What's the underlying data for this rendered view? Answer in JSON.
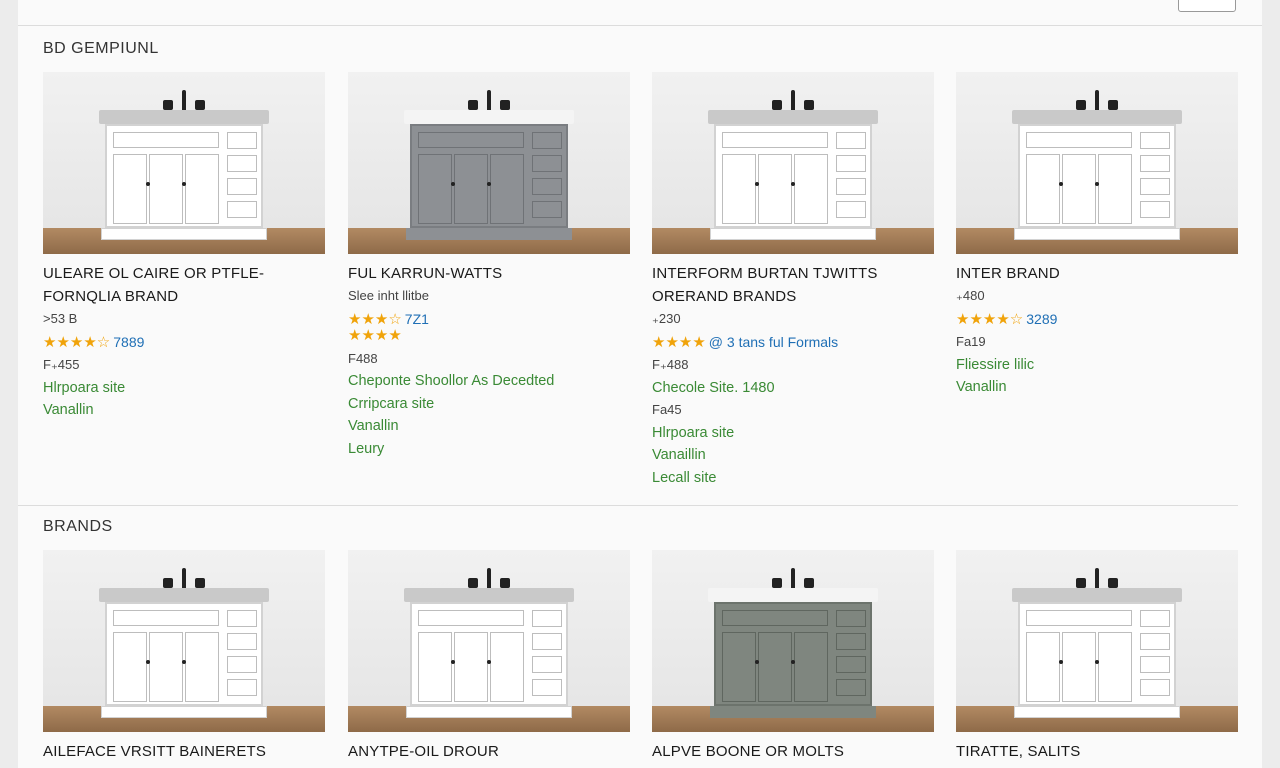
{
  "colors": {
    "accent_green": "#3a8a35",
    "accent_blue": "#1f6fb5",
    "star": "#f0a30a"
  },
  "sections": [
    {
      "title": "BD GEMPIUNL"
    },
    {
      "title": "BRANDS"
    }
  ],
  "products_top": [
    {
      "title": "ULEARE OL CAIRE OR PTFLE- FORNQLIA BRAND",
      "line1": ">53 B",
      "stars": "★★★★",
      "stars_empty": "☆",
      "rating": "7889",
      "price": "F₊455",
      "link1": "Hlrpoara site",
      "link2": "Vanallin",
      "cabinet_color": "#ffffff"
    },
    {
      "title": "FUL KARRUN-WATTS",
      "line1": "Slee inht llitbe",
      "stars": "★★★",
      "stars_empty": "☆",
      "rating": "7Z1",
      "stars2": "★★★",
      "stars2_empty": "★",
      "price": "F488",
      "link1": "Cheponte Shoollor As Decedted",
      "link2": "Crripcara site",
      "link3": "Vanallin",
      "link4": "Leury",
      "cabinet_color": "#8d9094"
    },
    {
      "title": "INTERFORM BURTAN TJWITTS ORERAND BRANDS",
      "line1": "₊230",
      "stars": "★★★★",
      "rating": "@ 3 tans ful Formals",
      "price": "F₊488",
      "link1": "Checole Site. 1480",
      "line2": "Fa45",
      "link2": "Hlrpoara site",
      "link3": "Vanaillin",
      "link4": "Lecall site",
      "cabinet_color": "#ffffff"
    },
    {
      "title": "INTER BRAND",
      "line1": "₊480",
      "stars": "★★★★",
      "stars_empty": "☆",
      "rating": "3289",
      "price": "Fa19",
      "link1": "Fliessire lilic",
      "link2": "Vanallin",
      "cabinet_color": "#ffffff"
    }
  ],
  "products_bottom": [
    {
      "title": "AILEFACE VRSITT BAINERETS",
      "cabinet_color": "#ffffff"
    },
    {
      "title": "ANYTPE-OIL DROUR",
      "cabinet_color": "#ffffff"
    },
    {
      "title": "ALPVE BOONE OR MOLTS",
      "cabinet_color": "#7f867f"
    },
    {
      "title": "TIRATTE, SALITS",
      "cabinet_color": "#ffffff"
    }
  ]
}
